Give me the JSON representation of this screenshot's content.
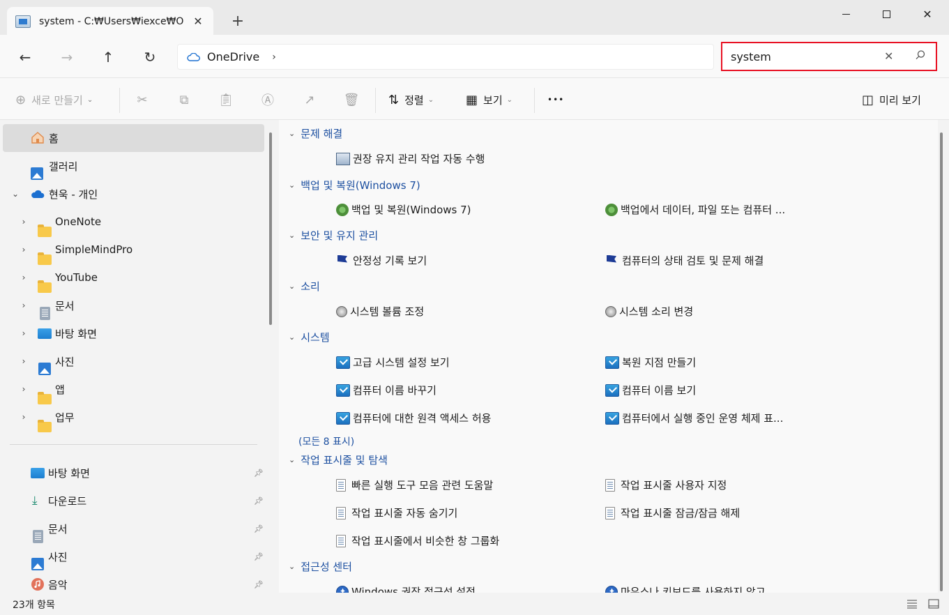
{
  "tab": {
    "title": "system - C:₩Users₩iexce₩One",
    "new_tab": "+"
  },
  "window": {
    "close": "✕"
  },
  "nav": {
    "back": "←",
    "forward": "→",
    "up": "↑",
    "refresh": "↻"
  },
  "address": {
    "location": "OneDrive",
    "chevron": "›"
  },
  "search": {
    "value": "system",
    "clear": "✕"
  },
  "toolbar": {
    "new_label": "새로 만들기",
    "sort_label": "정렬",
    "view_label": "보기",
    "more_label": "•••",
    "preview_label": "미리 보기"
  },
  "sidebar": {
    "top": [
      {
        "label": "홈"
      },
      {
        "label": "갤러리"
      },
      {
        "label": "현욱 - 개인"
      }
    ],
    "folders": [
      {
        "label": "OneNote"
      },
      {
        "label": "SimpleMindPro"
      },
      {
        "label": "YouTube"
      },
      {
        "label": "문서"
      },
      {
        "label": "바탕 화면"
      },
      {
        "label": "사진"
      },
      {
        "label": "앱"
      },
      {
        "label": "업무"
      }
    ],
    "quick": [
      {
        "label": "바탕 화면"
      },
      {
        "label": "다운로드"
      },
      {
        "label": "문서"
      },
      {
        "label": "사진"
      },
      {
        "label": "음악"
      }
    ]
  },
  "groups": [
    {
      "title": "문제 해결",
      "items": [
        "권장 유지 관리 작업 자동 수행"
      ]
    },
    {
      "title": "백업 및 복원(Windows 7)",
      "items": [
        "백업 및 복원(Windows 7)",
        "백업에서 데이터, 파일 또는 컴퓨터 ..."
      ]
    },
    {
      "title": "보안 및 유지 관리",
      "items": [
        "안정성 기록 보기",
        "컴퓨터의 상태 검토 및 문제 해결"
      ]
    },
    {
      "title": "소리",
      "items": [
        "시스템 볼륨 조정",
        "시스템 소리 변경"
      ]
    },
    {
      "title": "시스템",
      "items": [
        "고급 시스템 설정 보기",
        "복원 지점 만들기",
        "컴퓨터 이름 바꾸기",
        "컴퓨터 이름 보기",
        "컴퓨터에 대한 원격 액세스 허용",
        "컴퓨터에서 실행 중인 운영 체제 표..."
      ],
      "show_all": "(모든 8 표시)"
    },
    {
      "title": "작업 표시줄 및 탐색",
      "items": [
        "빠른 실행 도구 모음 관련 도움말",
        "작업 표시줄 사용자 지정",
        "작업 표시줄 자동 숨기기",
        "작업 표시줄 잠금/잠금 해제",
        "작업 표시줄에서 비슷한 창 그룹화"
      ]
    },
    {
      "title": "접근성 센터",
      "items": [
        "Windows 권장 접근성 설정",
        "마우스나 키보드를 사용하지 않고"
      ]
    }
  ],
  "status": {
    "count": "23개 항목"
  },
  "colors": {
    "accent": "#1c4fa0",
    "highlight_border": "#e81123",
    "folder": "#f8c94a"
  }
}
